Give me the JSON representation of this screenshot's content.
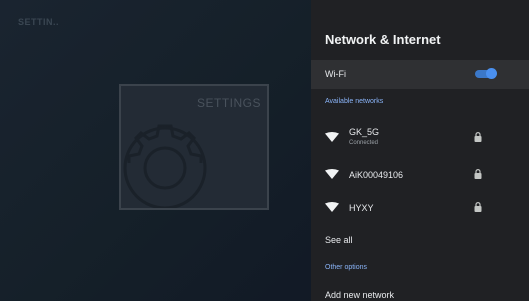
{
  "background": {
    "title": "SETTIN..",
    "card_label": "SETTINGS"
  },
  "panel": {
    "title": "Network & Internet",
    "wifi": {
      "label": "Wi-Fi",
      "enabled": true
    },
    "available_header": "Available networks",
    "networks": [
      {
        "name": "GK_5G",
        "status": "Connected",
        "secured": true,
        "icon": "wifi-icon",
        "lock_icon": "lock-icon"
      },
      {
        "name": "AiK00049106",
        "status": "",
        "secured": true,
        "icon": "wifi-icon",
        "lock_icon": "lock-icon"
      },
      {
        "name": "HYXY",
        "status": "",
        "secured": true,
        "icon": "wifi-icon",
        "lock_icon": "lock-icon"
      }
    ],
    "see_all": "See all",
    "other_header": "Other options",
    "add_network": "Add new network"
  },
  "colors": {
    "panel_bg": "#202124",
    "selected_row": "#2f3033",
    "accent": "#8ab4f8",
    "toggle_on": "#4a90f0"
  }
}
